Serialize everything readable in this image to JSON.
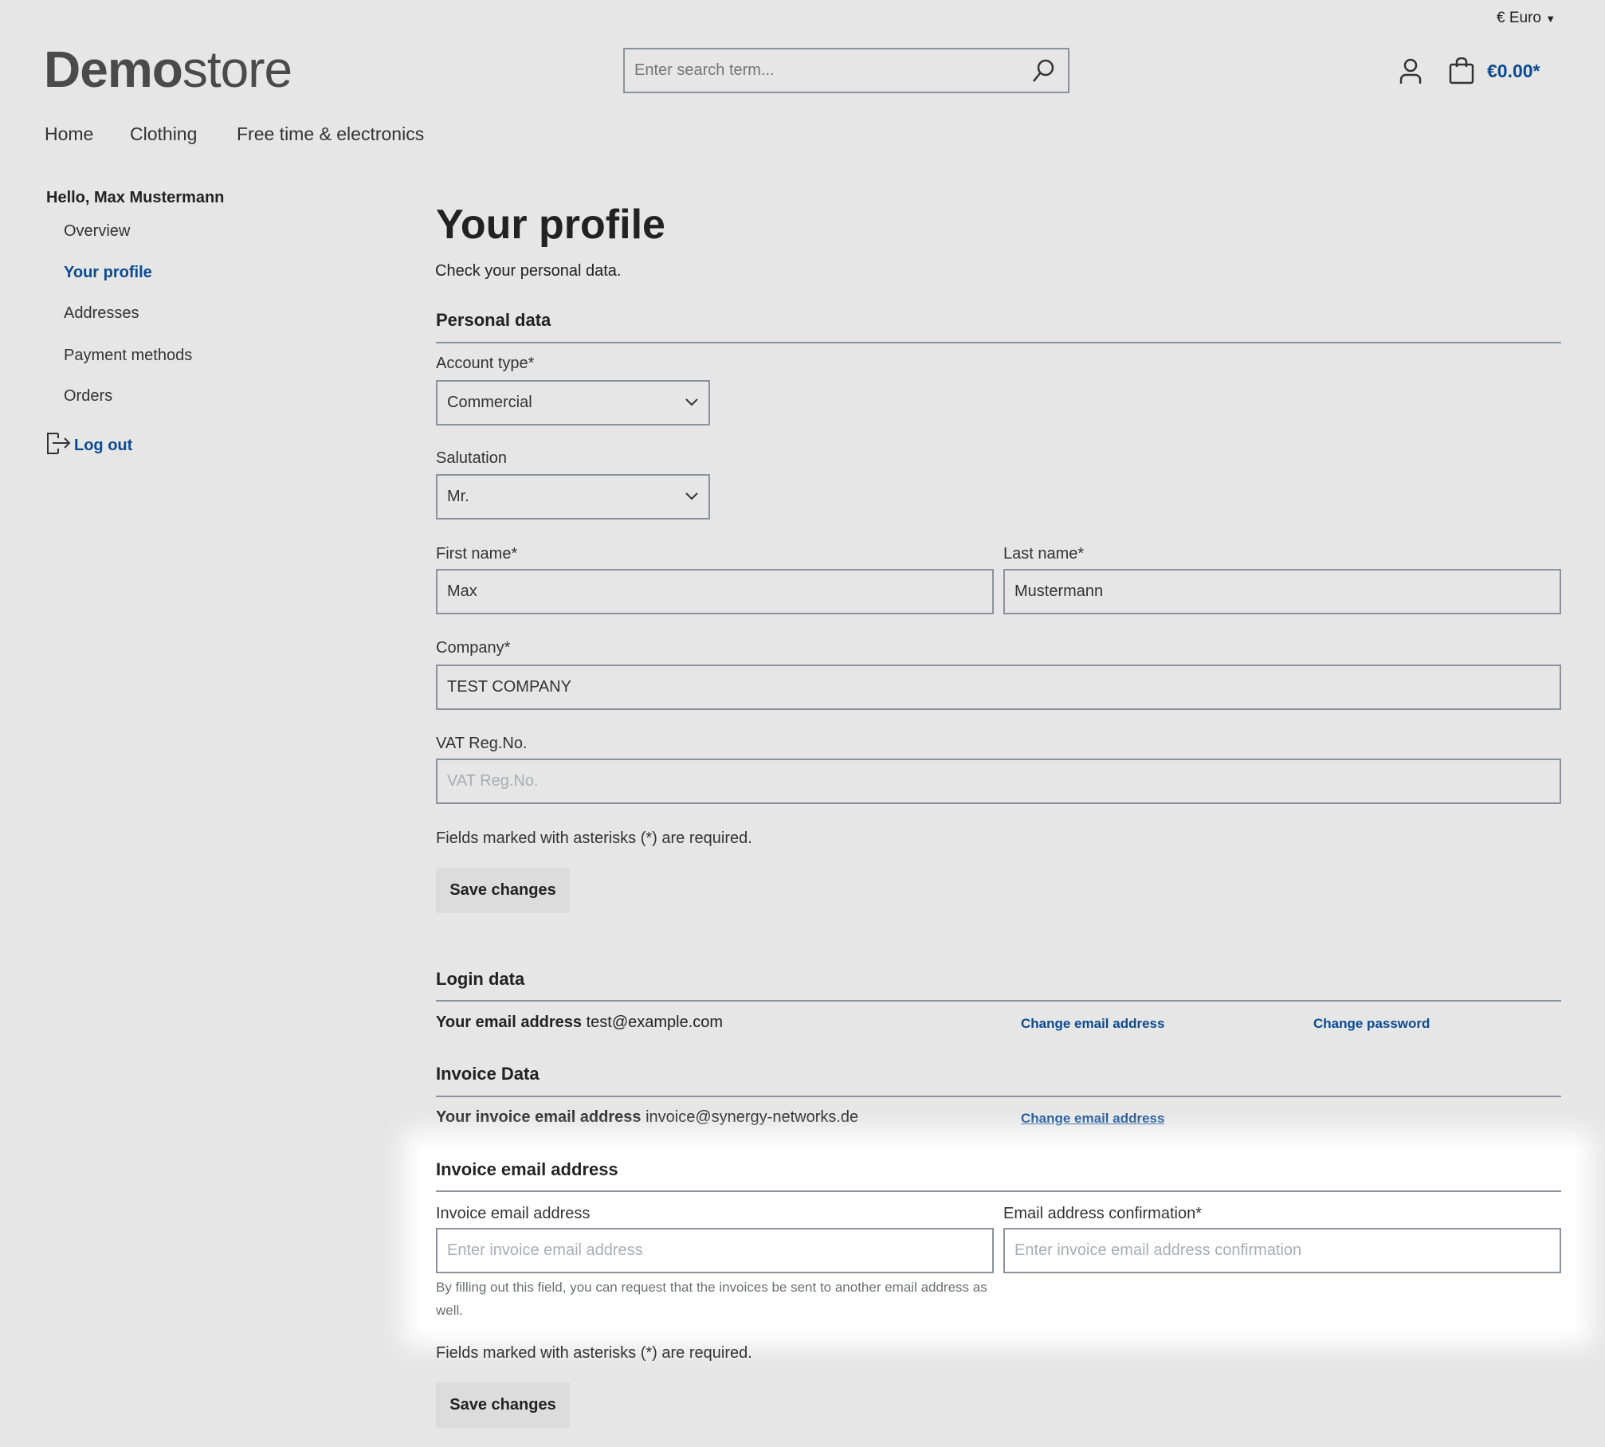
{
  "header": {
    "currency": "€ Euro",
    "logo_bold": "Demo",
    "logo_light": "store",
    "search_placeholder": "Enter search term...",
    "cart_total": "€0.00*"
  },
  "nav": [
    "Home",
    "Clothing",
    "Free time & electronics"
  ],
  "sidebar": {
    "greeting": "Hello, Max Mustermann",
    "items": [
      "Overview",
      "Your profile",
      "Addresses",
      "Payment methods",
      "Orders"
    ],
    "active": "Your profile",
    "logout": "Log out"
  },
  "main": {
    "title": "Your profile",
    "subtitle": "Check your personal data.",
    "personal": {
      "heading": "Personal data",
      "account_type_label": "Account type*",
      "account_type": "Commercial",
      "salutation_label": "Salutation",
      "salutation": "Mr.",
      "first_name_label": "First name*",
      "first_name": "Max",
      "last_name_label": "Last name*",
      "last_name": "Mustermann",
      "company_label": "Company*",
      "company": "TEST COMPANY",
      "vat_label": "VAT Reg.No.",
      "vat_placeholder": "VAT Reg.No.",
      "required_note": "Fields marked with asterisks (*) are required.",
      "save": "Save changes"
    },
    "login": {
      "heading": "Login data",
      "email_label": "Your email address",
      "email": "test@example.com",
      "change_email": "Change email address",
      "change_password": "Change password"
    },
    "invoice": {
      "heading": "Invoice Data",
      "email_label": "Your invoice email address",
      "email": "invoice@synergy-networks.de",
      "change_email": "Change email address"
    },
    "invoice_form": {
      "heading": "Invoice email address",
      "email_label": "Invoice email address",
      "email_placeholder": "Enter invoice email address",
      "confirm_label": "Email address confirmation*",
      "confirm_placeholder": "Enter invoice email address confirmation",
      "help": "By filling out this field, you can request that the invoices be sent to another email address as well.",
      "required_note": "Fields marked with asterisks (*) are required.",
      "save": "Save changes"
    }
  },
  "colors": {
    "accent": "#0b4a8f",
    "background": "#e6e6e6",
    "border": "#8a929c"
  }
}
